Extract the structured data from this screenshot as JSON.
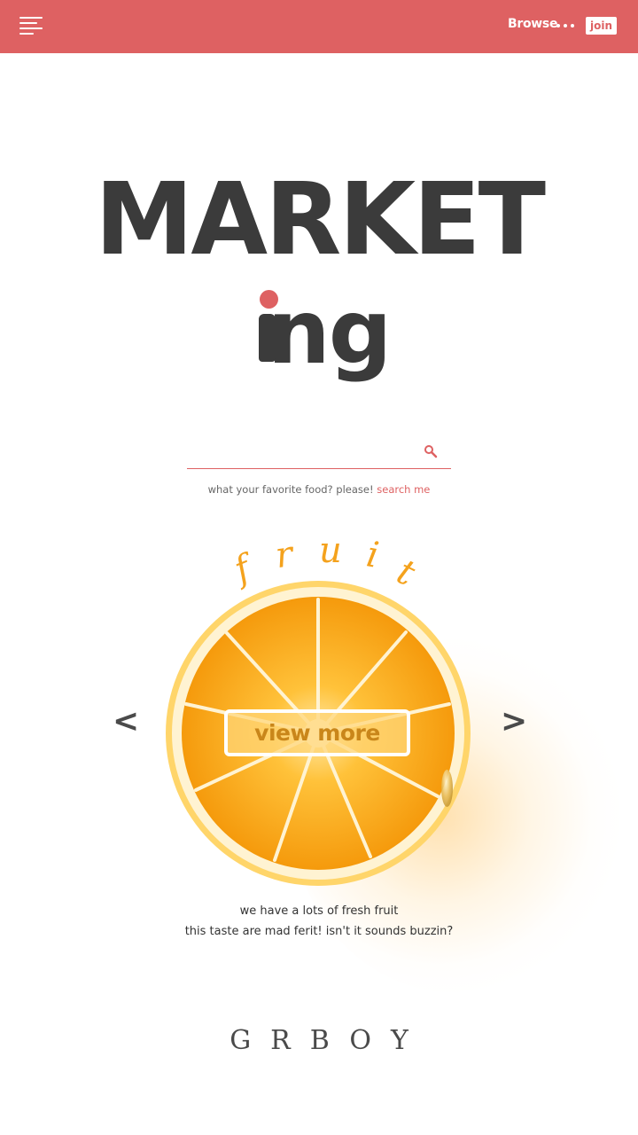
{
  "header": {
    "browse_label": "Browse",
    "join_label": "join",
    "accent_color": "#de6162"
  },
  "hero": {
    "title_line1": "MARKET",
    "title_line2_rest": "ng"
  },
  "search": {
    "placeholder": "",
    "hint_text": "what your favorite food? please! ",
    "hint_link": "search me",
    "icon": "search-icon"
  },
  "carousel": {
    "heading_letters": [
      "f",
      "r",
      "u",
      "i",
      "t"
    ],
    "button_label": "view more",
    "prev_label": "<",
    "next_label": ">",
    "description_line1": "we have a lots of fresh fruit",
    "description_line2": "this taste are mad ferit! isn't it sounds buzzin?",
    "highlight_color": "#f4a21d"
  },
  "footer": {
    "brand": "GRBOY"
  }
}
